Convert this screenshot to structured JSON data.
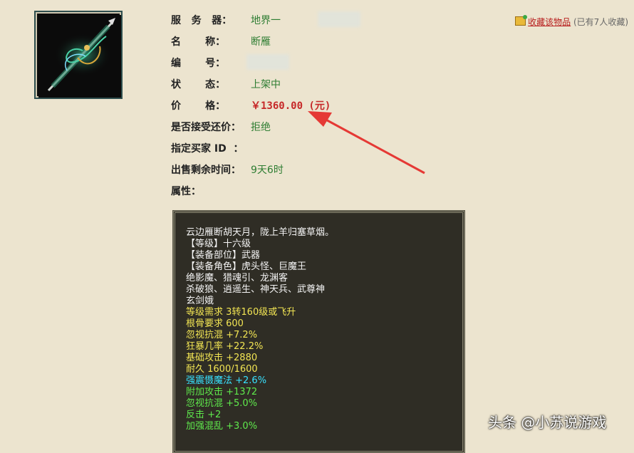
{
  "item_image": {
    "icon": "sword-icon"
  },
  "favorite": {
    "link_text": "收藏该物品",
    "count_text": "(已有7人收藏)"
  },
  "details": {
    "server_label": "服   务   器：",
    "server_value": "地界一",
    "name_label": "名       称：",
    "name_value": "断雁",
    "id_label": "编       号：",
    "status_label": "状       态：",
    "status_value": "上架中",
    "price_label": "价       格：",
    "price_value": "￥1360.00 (元)",
    "bargain_label": "是否接受还价：",
    "bargain_value": "拒绝",
    "buyer_label": "指定买家 ID  ：",
    "time_label": "出售剩余时间：",
    "time_value": "9天6时",
    "attr_label": "属性："
  },
  "attributes": [
    {
      "text": "云边雁断胡天月，陇上羊归塞草烟。",
      "color": "white"
    },
    {
      "text": "【等级】十六级",
      "color": "white"
    },
    {
      "text": "【装备部位】武器",
      "color": "white"
    },
    {
      "text": "【装备角色】虎头怪、巨魔王",
      "color": "white"
    },
    {
      "text": "绝影魔、猎魂引、龙渊客",
      "color": "white"
    },
    {
      "text": "杀破狼、逍遥生、神天兵、武尊神",
      "color": "white"
    },
    {
      "text": "玄剑娥",
      "color": "white"
    },
    {
      "text": "等级需求 3转160级或飞升",
      "color": "yellow"
    },
    {
      "text": "根骨要求 600",
      "color": "yellow"
    },
    {
      "text": "忽视抗混 +7.2%",
      "color": "yellow"
    },
    {
      "text": "狂暴几率 +22.2%",
      "color": "yellow"
    },
    {
      "text": "基础攻击 +2880",
      "color": "yellow"
    },
    {
      "text": "耐久 1600/1600",
      "color": "yellow"
    },
    {
      "text": "强震慑魔法 +2.6%",
      "color": "cyan"
    },
    {
      "text": "附加攻击 +1372",
      "color": "green"
    },
    {
      "text": "忽视抗混 +5.0%",
      "color": "green"
    },
    {
      "text": "反击 +2",
      "color": "green"
    },
    {
      "text": "加强混乱 +3.0%",
      "color": "green"
    }
  ],
  "watermark": "头条 @小苏说游戏",
  "colors": {
    "label": "#222222",
    "value": "#2e7d32",
    "price": "#c62828",
    "arrow": "#e53935"
  }
}
